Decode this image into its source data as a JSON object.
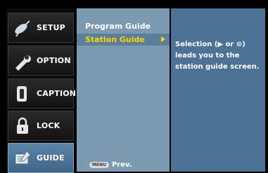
{
  "sidebar": {
    "items": [
      {
        "label": "SETUP",
        "icon": "satellite-dish-icon"
      },
      {
        "label": "OPTION",
        "icon": "wrench-icon"
      },
      {
        "label": "CAPTION",
        "icon": "caption-icon"
      },
      {
        "label": "LOCK",
        "icon": "padlock-icon"
      },
      {
        "label": "GUIDE",
        "icon": "guide-icon"
      }
    ]
  },
  "menu": {
    "items": [
      "Program Guide",
      "Station Guide"
    ],
    "footer_key": "MENU",
    "footer_label": "Prev."
  },
  "info": {
    "text": "Selection (▶ or ⊙) leads you to the station guide screen."
  },
  "colors": {
    "highlight": "#ffd400",
    "menu_bg": "#7d9ab3",
    "info_bg": "#4c7395"
  }
}
